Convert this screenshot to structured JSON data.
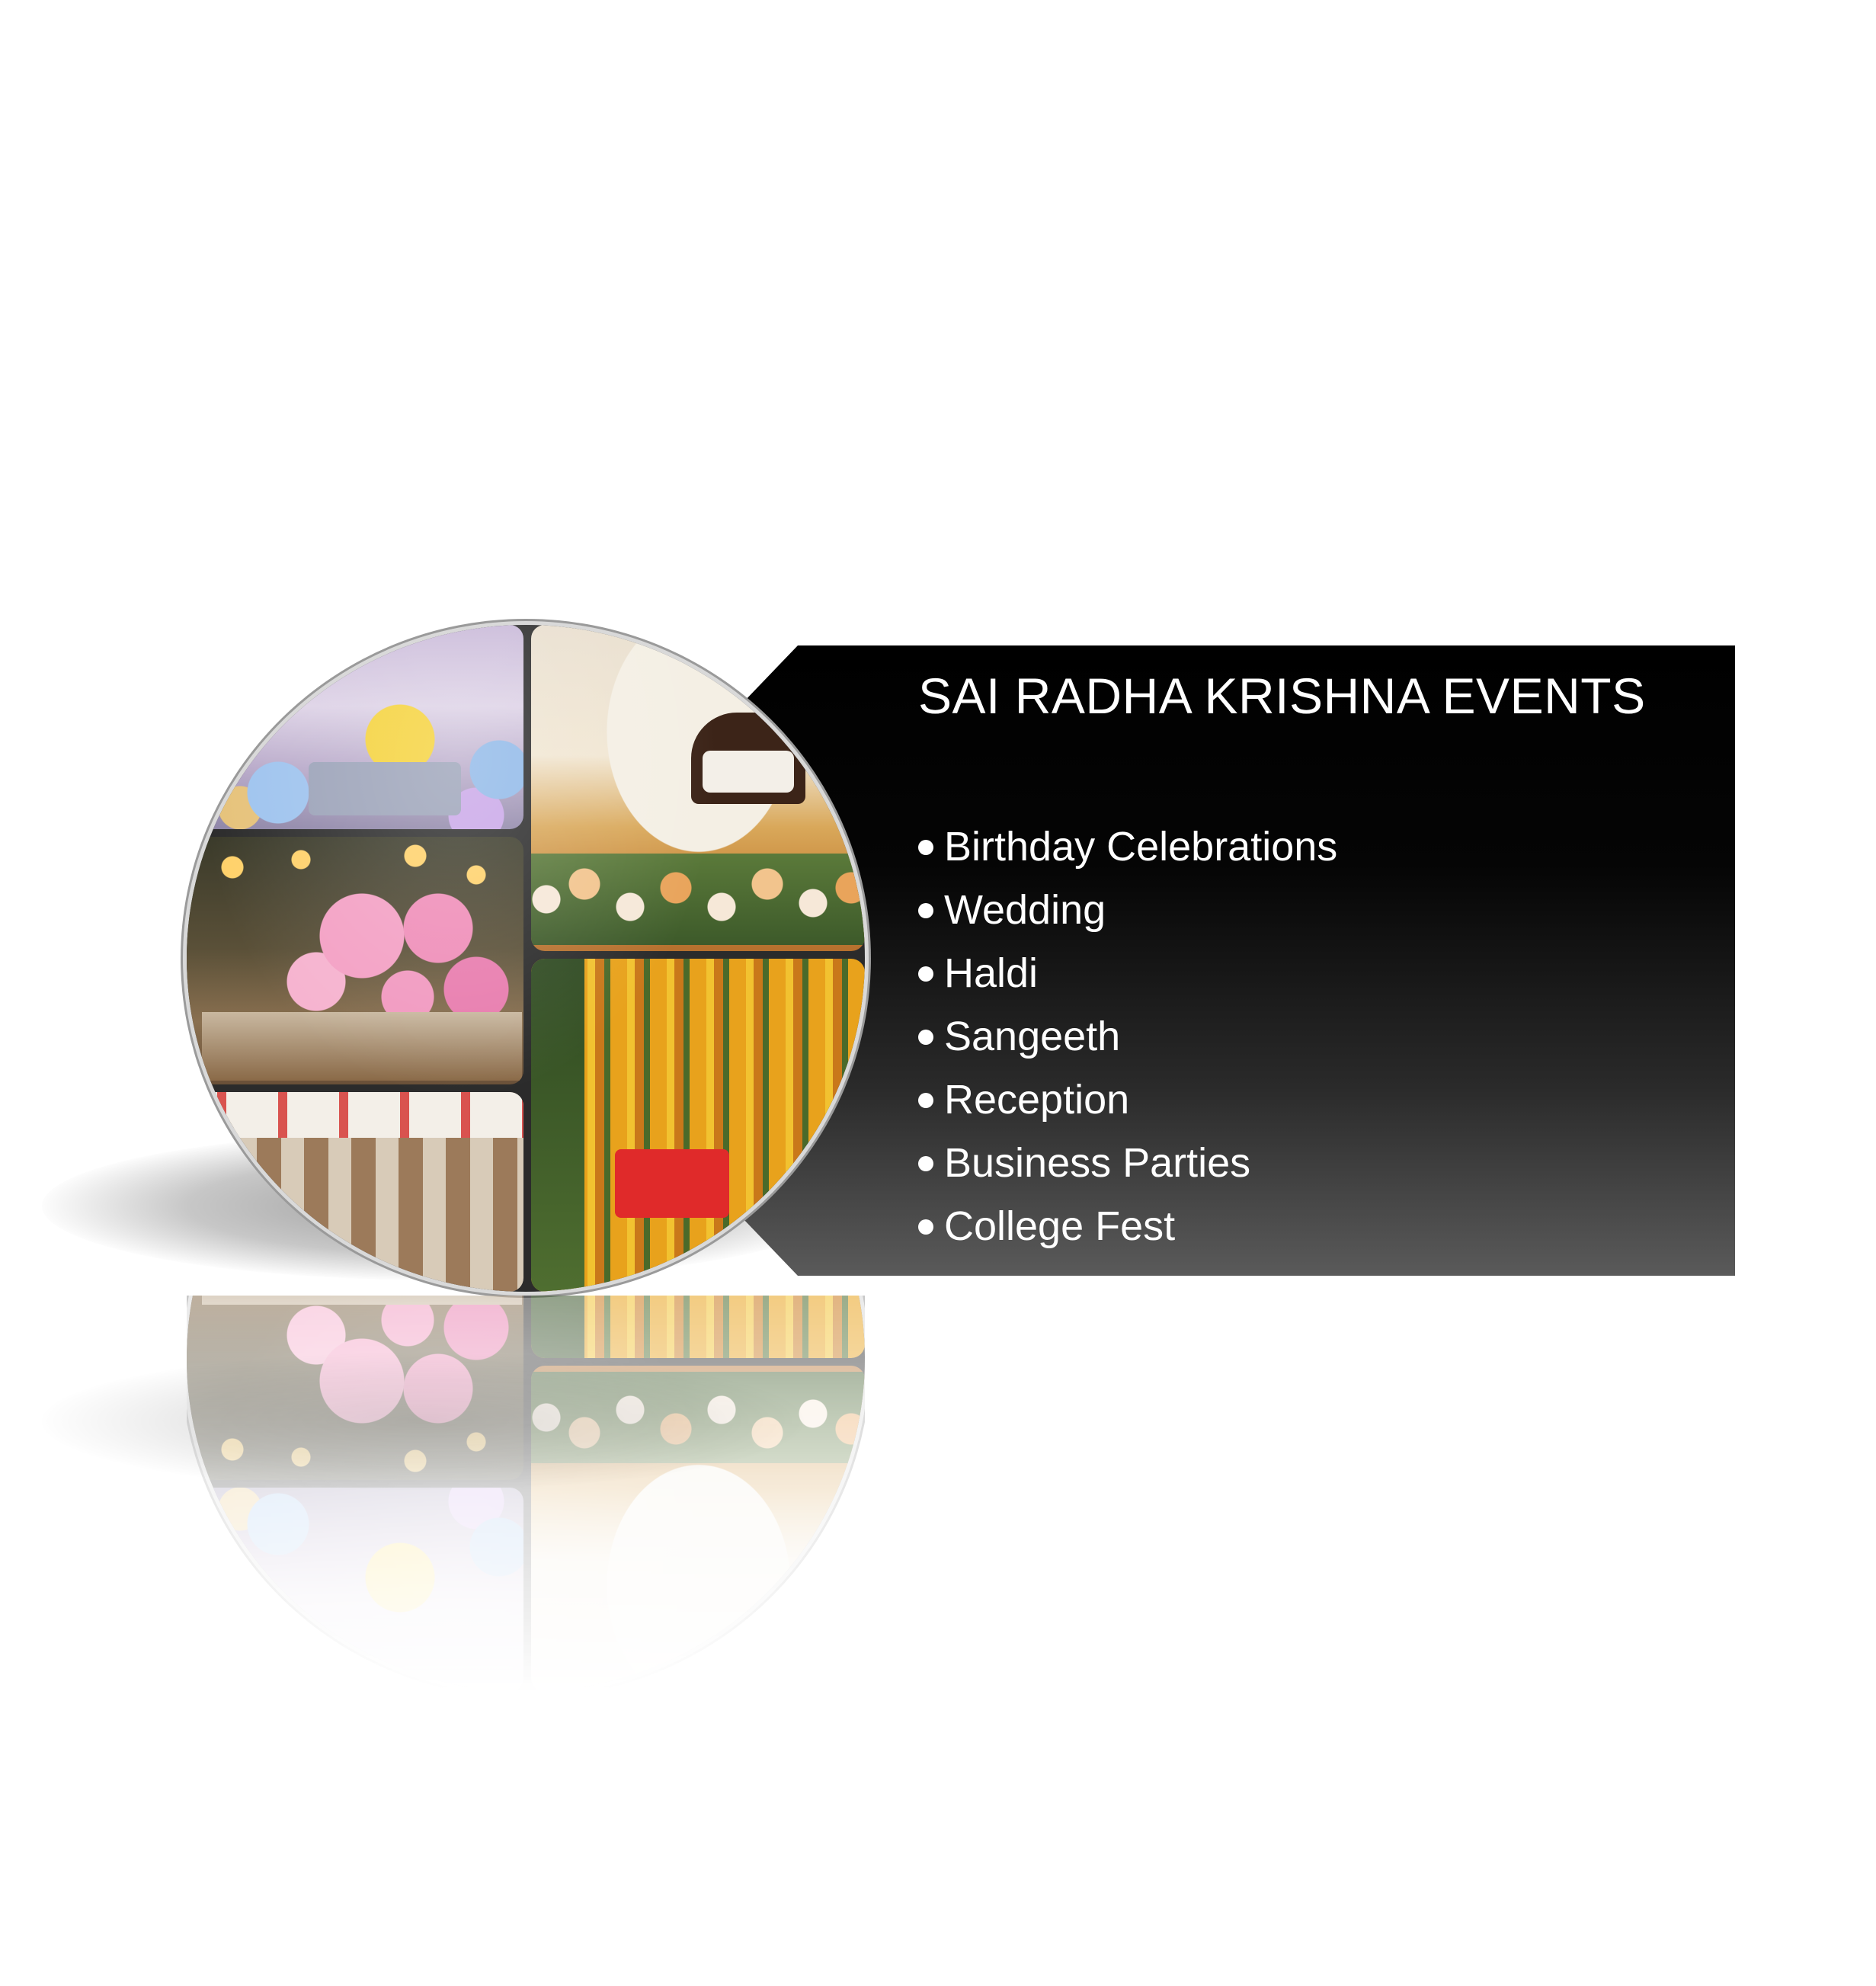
{
  "title": "SAI RADHA KRISHNA EVENTS",
  "services": [
    "Birthday Celebrations",
    "Wedding",
    "Haldi",
    "Sangeeth",
    "Reception",
    "Business Parties",
    "College Fest"
  ],
  "colors": {
    "panel_top": "#000000",
    "panel_bottom": "#5a5a5a",
    "text": "#ffffff",
    "background": "#ffffff"
  }
}
